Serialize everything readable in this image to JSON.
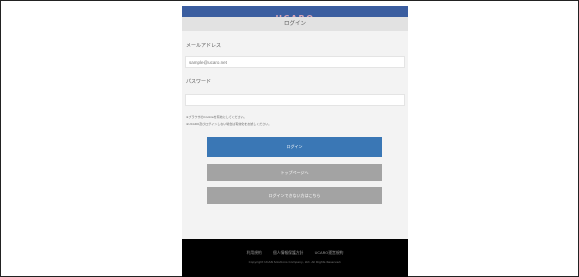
{
  "brand": {
    "logo_text": "UCARO",
    "logo_color": "#d9a6b6",
    "bar_color": "#3b5ea0"
  },
  "header": {
    "title": "ログイン"
  },
  "form": {
    "email_label": "メールアドレス",
    "email_placeholder": "sample@ucaro.net",
    "email_value": "",
    "password_label": "パスワード",
    "password_value": ""
  },
  "notes": [
    "※ブラウザのCookieを有効にしてください。",
    "※UCARO及びログインしない場合は有効化をお試しください。"
  ],
  "buttons": {
    "login": "ログイン",
    "top_page": "トップページへ",
    "forgot": "ログインできない方はこちら"
  },
  "footer": {
    "links": [
      "利用規約",
      "個人情報保護方針",
      "UCARO運営規約"
    ],
    "copyright": "Copyright UCAN Solutions Company, Ltd. All Rights Reserved."
  },
  "colors": {
    "primary_button": "#3a77b5",
    "secondary_button": "#a3a3a3",
    "footer_bg": "#000000"
  }
}
